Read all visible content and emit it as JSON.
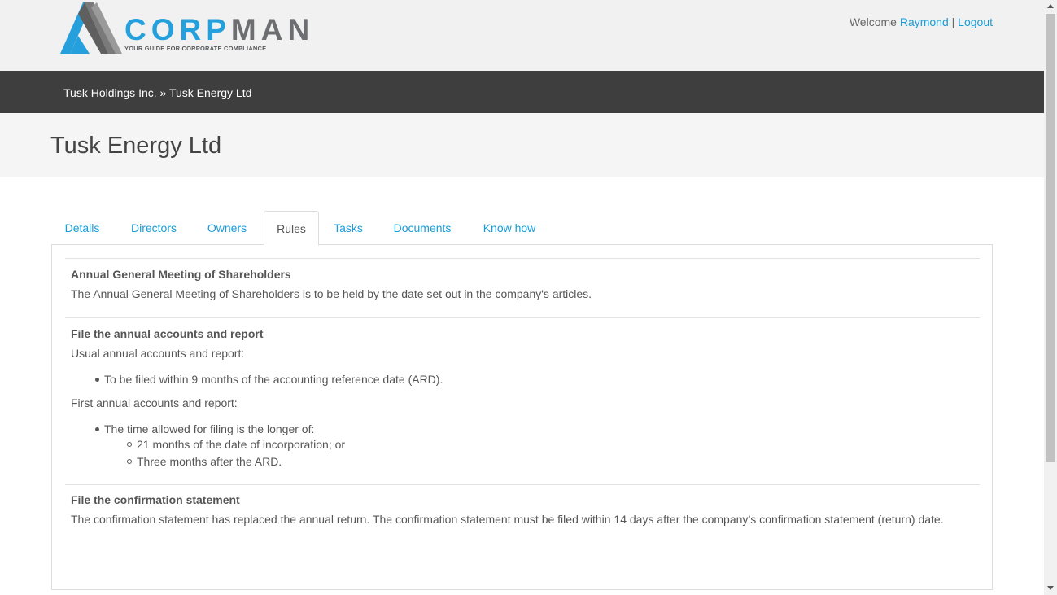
{
  "brand": {
    "name_part1": "CORP",
    "name_part2": "MAN",
    "tagline": "YOUR GUIDE FOR CORPORATE COMPLIANCE",
    "accent_color": "#26a0dc",
    "dark_color": "#6d6e71"
  },
  "user": {
    "welcome": "Welcome",
    "name": "Raymond",
    "separator": "|",
    "logout": "Logout"
  },
  "breadcrumb": {
    "parent": "Tusk Holdings Inc.",
    "separator": "»",
    "current": "Tusk Energy Ltd"
  },
  "page": {
    "title": "Tusk Energy Ltd"
  },
  "tabs": [
    {
      "label": "Details"
    },
    {
      "label": "Directors"
    },
    {
      "label": "Owners"
    },
    {
      "label": "Rules",
      "active": true
    },
    {
      "label": "Tasks"
    },
    {
      "label": "Documents"
    },
    {
      "label": "Know how"
    }
  ],
  "rules": [
    {
      "title": "Annual General Meeting of Shareholders",
      "text": "The Annual General Meeting of Shareholders is to be held by the date set out in the company's articles."
    },
    {
      "title": "File the annual accounts and report",
      "intro1": "Usual annual accounts and report:",
      "bullet1": "To be filed within 9 months of the accounting reference date (ARD).",
      "intro2": "First annual accounts and report:",
      "bullet2": "The time allowed for filing is the longer of:",
      "sub1": "21 months of the date of incorporation; or",
      "sub2": "Three months after the ARD."
    },
    {
      "title": "File the confirmation statement",
      "text": "The confirmation statement has replaced the annual return. The confirmation statement must be filed within 14 days after the company’s confirmation statement (return) date."
    }
  ]
}
